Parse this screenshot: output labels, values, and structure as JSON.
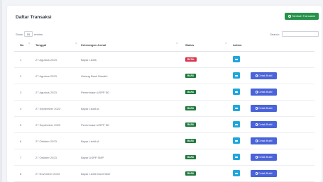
{
  "card": {
    "title": "Daftar Transaksi",
    "add_button": "Tambah Transaksi"
  },
  "controls": {
    "show_label": "Show",
    "entries_value": "10",
    "entries_label": "entries",
    "search_label": "Search:"
  },
  "table": {
    "headers": [
      "No",
      "Tanggal",
      "Keterangan Jurnal",
      "Status",
      "Action"
    ],
    "rows": [
      {
        "no": "1",
        "tanggal": "27 Agustus 2023",
        "keterangan": "Bayar Listrik",
        "status": "BATAL",
        "print": ""
      },
      {
        "no": "2",
        "tanggal": "27 Agustus 2023",
        "keterangan": "Hutang Bank Mandiri",
        "status": "BARU",
        "print": "Cetak Bukti"
      },
      {
        "no": "3",
        "tanggal": "27 Agustus 2023",
        "keterangan": "Penerimaan USPP SD",
        "status": "BARU",
        "print": "Cetak Bukti"
      },
      {
        "no": "4",
        "tanggal": "27 September 2023",
        "keterangan": "Bayar Listrik A",
        "status": "BARU",
        "print": "Cetak Bukti"
      },
      {
        "no": "5",
        "tanggal": "27 September 2023",
        "keterangan": "Penerimaan USPP SD",
        "status": "BARU",
        "print": "Cetak Bukti"
      },
      {
        "no": "6",
        "tanggal": "27 Oktober 2023",
        "keterangan": "Bayar Listrik A",
        "status": "BARU",
        "print": "Cetak Bukti"
      },
      {
        "no": "7",
        "tanggal": "27 Oktober 2023",
        "keterangan": "Bayar USPP SMP",
        "status": "BARU",
        "print": "Cetak Bukti"
      },
      {
        "no": "8",
        "tanggal": "27 November 2023",
        "keterangan": "Bayar Listrik November",
        "status": "BARU",
        "print": "Cetak Bukti"
      }
    ]
  },
  "colors": {
    "add_button": "#27924a",
    "status_batal": "#d9334a",
    "status_baru": "#1f7a3d",
    "edit_button": "#1fa6dc",
    "print_button": "#4a63d8"
  },
  "icons": {
    "add": "plus-circle-icon",
    "edit": "edit-icon",
    "print": "print-icon",
    "sort": "sort-icon"
  }
}
